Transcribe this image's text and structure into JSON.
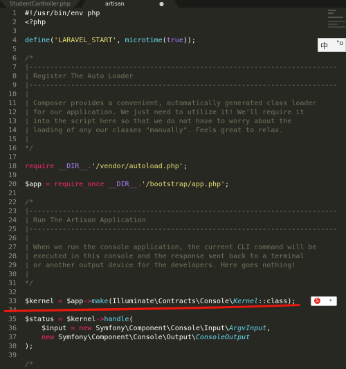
{
  "tabs": [
    {
      "label": "StudentController.php",
      "active": false
    },
    {
      "label": "artisan",
      "active": true
    }
  ],
  "tab_modified_glyph": "●",
  "tab_close_glyph": "×",
  "ime": {
    "lang": "中",
    "punct": "°o"
  },
  "sogou": {
    "logo": "S",
    "arrow": "▾"
  },
  "line_numbers": [
    "1",
    "2",
    "3",
    "4",
    "5",
    "6",
    "7",
    "8",
    "9",
    "10",
    "11",
    "12",
    "13",
    "14",
    "15",
    "16",
    "17",
    "18",
    "19",
    "20",
    "21",
    "22",
    "23",
    "24",
    "25",
    "26",
    "27",
    "28",
    "29",
    "30",
    "31",
    "32",
    "33",
    "34",
    "35",
    "36",
    "37",
    "38",
    "39"
  ],
  "code": {
    "l1": "#!/usr/bin/env php",
    "l2": "<?php",
    "l4_fn": "define",
    "l4_a": "(",
    "l4_str": "'LARAVEL_START'",
    "l4_b": ", ",
    "l4_fn2": "microtime",
    "l4_c": "(",
    "l4_true": "true",
    "l4_d": "));",
    "l6": "/*",
    "l7": "|--------------------------------------------------------------------------",
    "l8": "| Register The Auto Loader",
    "l9": "|--------------------------------------------------------------------------",
    "l10": "|",
    "l11": "| Composer provides a convenient, automatically generated class loader",
    "l12": "| for our application. We just need to utilize it! We'll require it",
    "l13": "| into the script here so that we do not have to worry about the",
    "l14": "| loading of any our classes \"manually\". Feels great to relax.",
    "l15": "|",
    "l16": "*/",
    "l18_kw": "require",
    "l18_sp": " ",
    "l18_const": "__DIR__",
    "l18_dot": ".",
    "l18_str": "'/vendor/autoload.php'",
    "l18_end": ";",
    "l20_var": "$app",
    "l20_eq": " = ",
    "l20_kw": "require_once",
    "l20_sp": " ",
    "l20_const": "__DIR__",
    "l20_dot": ".",
    "l20_str": "'/bootstrap/app.php'",
    "l20_end": ";",
    "l22": "/*",
    "l23": "|--------------------------------------------------------------------------",
    "l24": "| Run The Artisan Application",
    "l25": "|--------------------------------------------------------------------------",
    "l26": "|",
    "l27": "| When we run the console application, the current CLI command will be",
    "l28": "| executed in this console and the response sent back to a terminal",
    "l29": "| or another output device for the developers. Here goes nothing!",
    "l30": "|",
    "l31": "*/",
    "l33_var": "$kernel",
    "l33_eq": " = ",
    "l33_var2": "$app",
    "l33_arrow": "->",
    "l33_fn": "make",
    "l33_ns": "(Illuminate\\Contracts\\Console\\",
    "l33_cls": "Kernel",
    "l33_end": "::class);",
    "l35_var": "$status",
    "l35_eq": " = ",
    "l35_var2": "$kernel",
    "l35_arrow": "->",
    "l35_fn": "handle",
    "l35_end": "(",
    "l36_pad": "    ",
    "l36_var": "$input",
    "l36_eq": " = ",
    "l36_kw": "new",
    "l36_ns": " Symfony\\Component\\Console\\Input\\",
    "l36_cls": "ArgvInput",
    "l36_end": ",",
    "l37_pad": "    ",
    "l37_kw": "new",
    "l37_ns": " Symfony\\Component\\Console\\Output\\",
    "l37_cls": "ConsoleOutput",
    "l38": ");",
    "l39": "/*"
  },
  "colors": {
    "background": "#272822",
    "comment": "#75715e",
    "string": "#e6db74",
    "keyword": "#f92672",
    "function": "#66d9ef",
    "constant": "#ae81ff",
    "annotation": "#e8180c"
  }
}
